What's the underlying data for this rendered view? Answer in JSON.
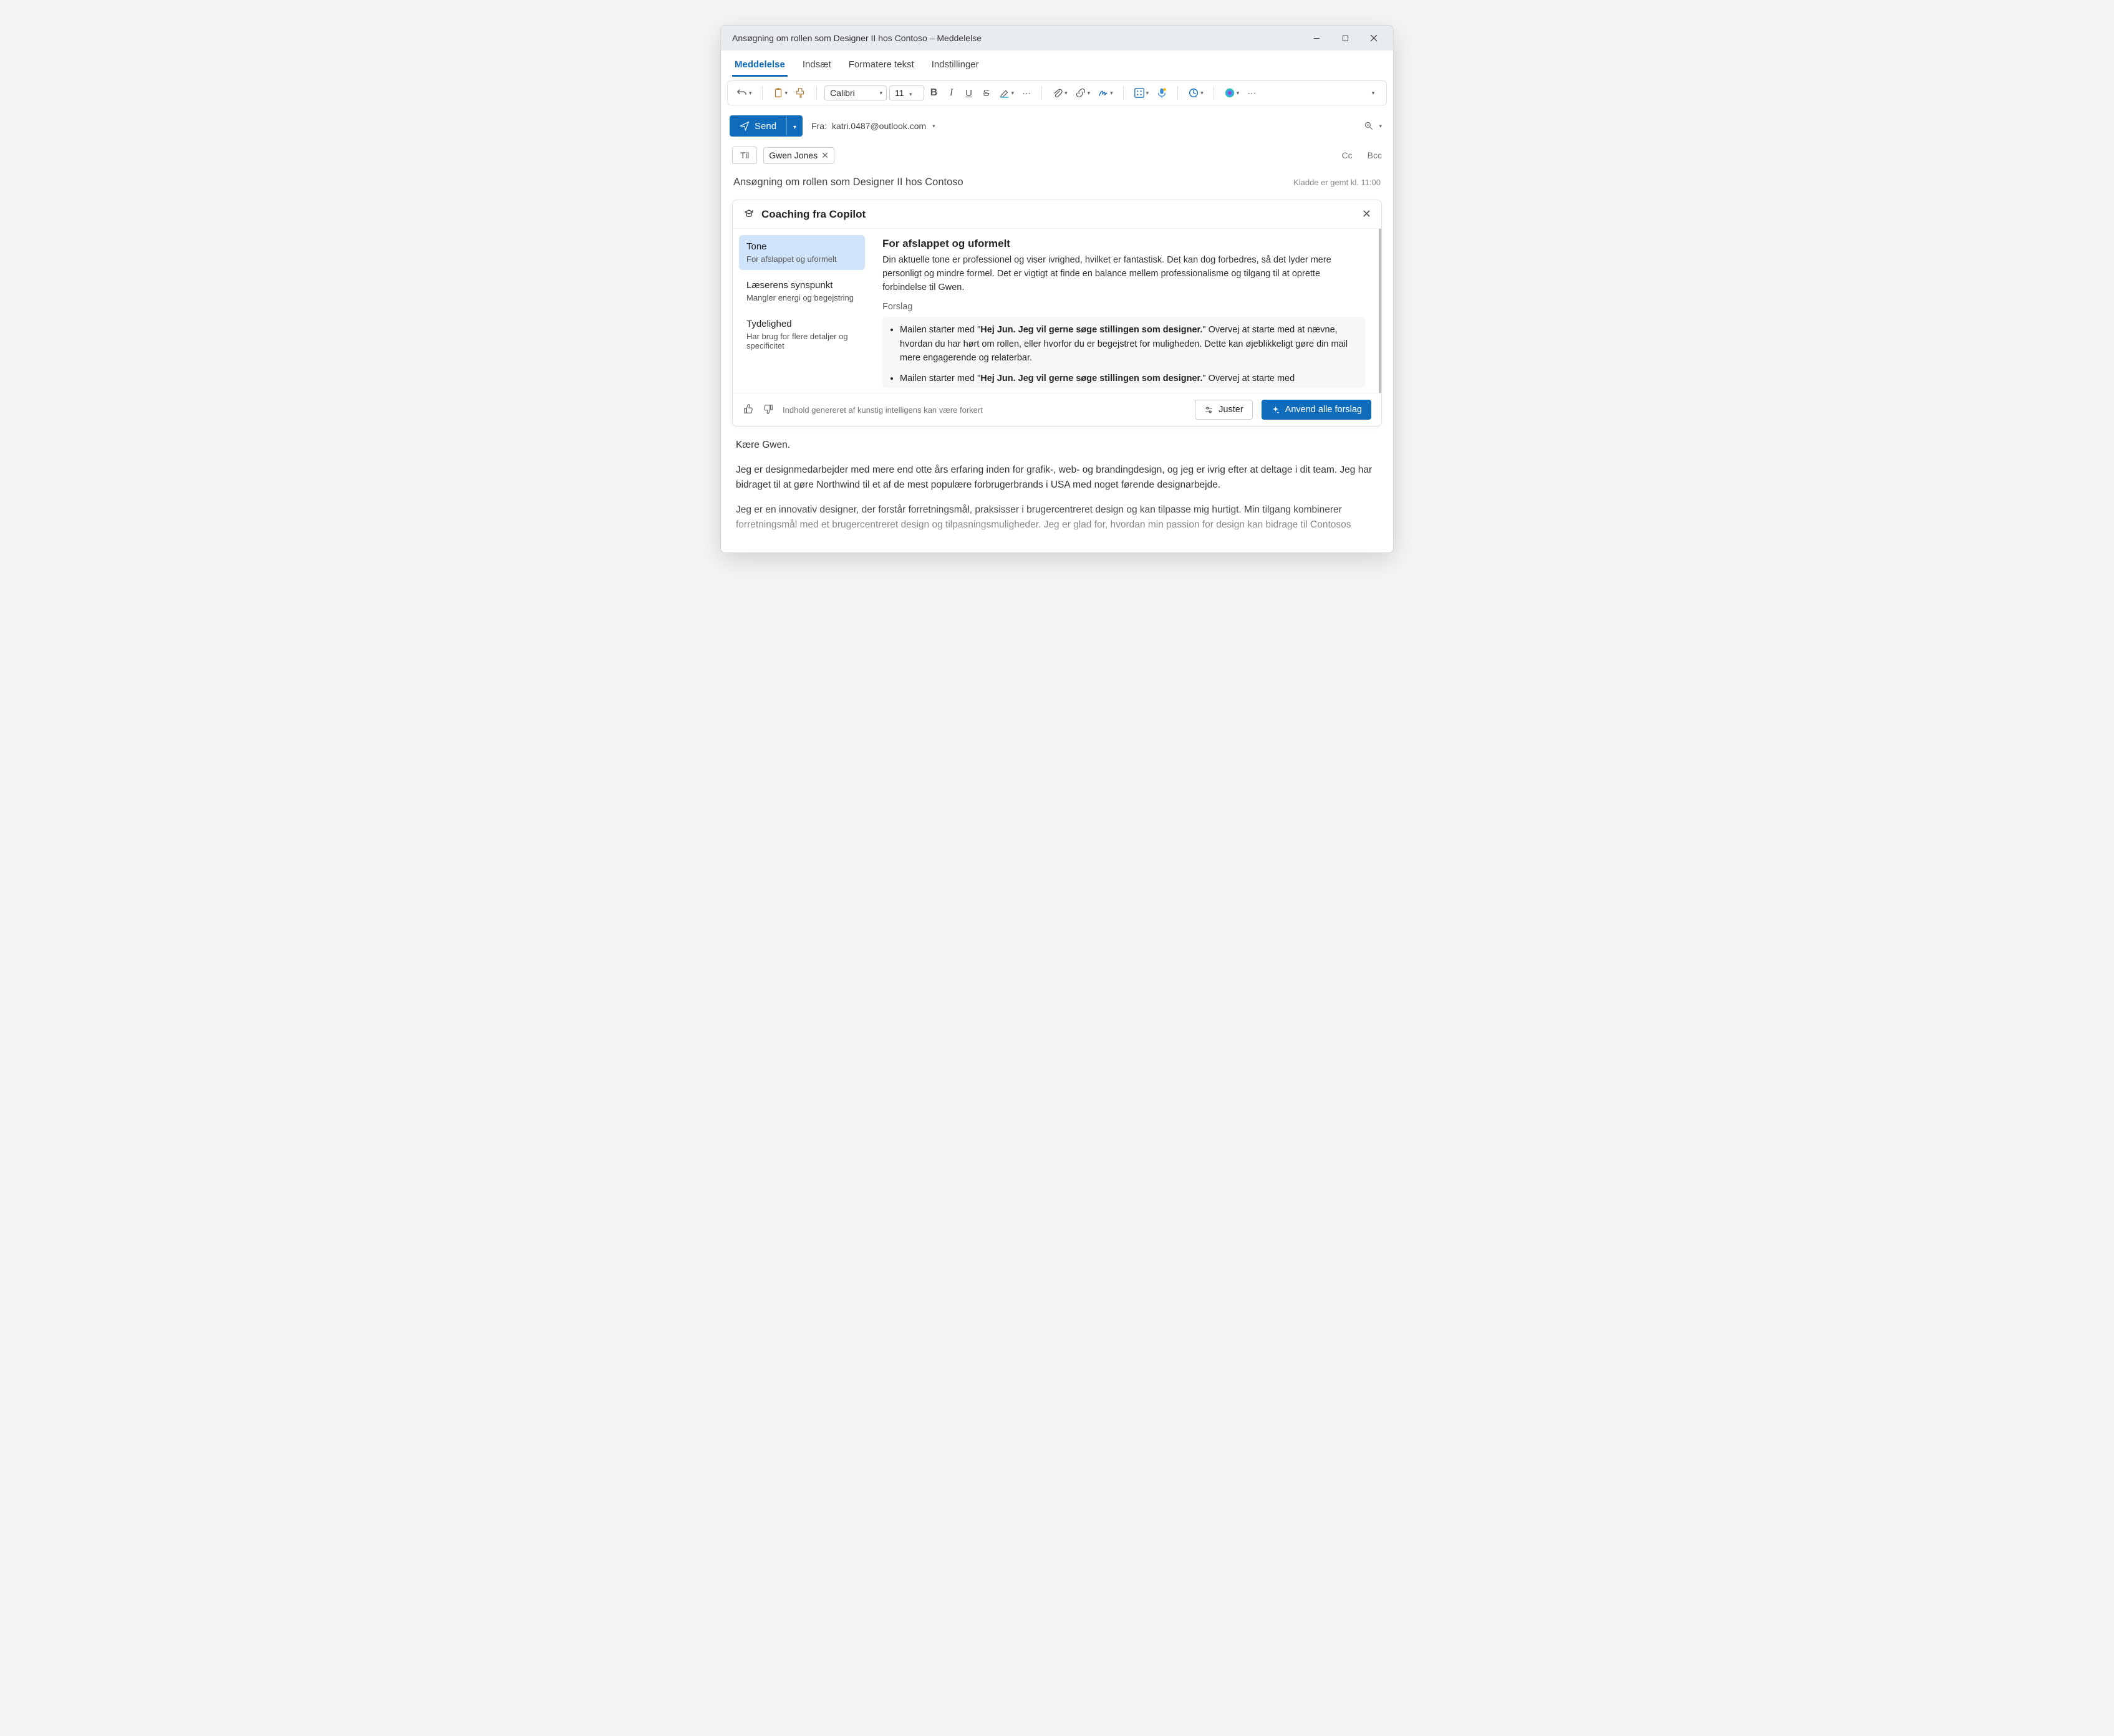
{
  "window": {
    "title": "Ansøgning om rollen som Designer II hos Contoso – Meddelelse"
  },
  "tabs": {
    "message": "Meddelelse",
    "insert": "Indsæt",
    "format": "Formatere tekst",
    "options": "Indstillinger"
  },
  "toolbar": {
    "font_name": "Calibri",
    "font_size": "11"
  },
  "send": {
    "label": "Send",
    "from_prefix": "Fra:",
    "from_email": "katri.0487@outlook.com"
  },
  "recipients": {
    "to_label": "Til",
    "to_chip": "Gwen Jones",
    "cc": "Cc",
    "bcc": "Bcc"
  },
  "subject": "Ansøgning om rollen som Designer II hos Contoso",
  "draft_status": "Kladde er gemt kl. 11:00",
  "copilot": {
    "title": "Coaching fra Copilot",
    "side": [
      {
        "title": "Tone",
        "sub": "For afslappet og uformelt"
      },
      {
        "title": "Læserens synspunkt",
        "sub": "Mangler energi og begejstring"
      },
      {
        "title": "Tydelighed",
        "sub": "Har brug for flere detaljer og specificitet"
      }
    ],
    "main": {
      "heading": "For afslappet og uformelt",
      "para": "Din aktuelle tone er professionel og viser ivrighed, hvilket er fantastisk. Det kan dog forbedres, så det lyder mere personligt og mindre formel. Det er vigtigt at finde en balance mellem professionalisme og tilgang til at oprette forbindelse til Gwen.",
      "forslag_label": "Forslag",
      "bullet1_pre": "Mailen starter med \"",
      "bullet1_bold": "Hej Jun. Jeg vil gerne søge stillingen som designer.",
      "bullet1_post": "\"  Overvej at starte med at nævne, hvordan du har hørt om rollen, eller hvorfor du er begejstret for muligheden. Dette kan øjeblikkeligt gøre din mail mere engagerende og relaterbar.",
      "bullet2_pre": "Mailen starter med \"",
      "bullet2_bold": "Hej Jun. Jeg vil gerne søge stillingen som designer.",
      "bullet2_post": "\"  Overvej at starte med"
    },
    "footer": {
      "ai_note": "Indhold genereret af kunstig intelligens kan være forkert",
      "adjust": "Juster",
      "apply": "Anvend alle forslag"
    }
  },
  "body": {
    "greeting": "Kære Gwen.",
    "p1": "Jeg er designmedarbejder med mere end otte års erfaring inden for grafik-, web- og brandingdesign, og jeg er ivrig efter at deltage i dit team. Jeg har bidraget til at gøre Northwind til et af de mest populære forbrugerbrands i USA med noget førende designarbejde.",
    "p2": "Jeg er en innovativ designer, der forstår forretningsmål, praksisser i brugercentreret design og kan tilpasse mig hurtigt. Min tilgang kombinerer forretningsmål med et brugercentreret design og tilpasningsmuligheder. Jeg er glad for, hvordan min passion for design kan bidrage til Contosos"
  }
}
